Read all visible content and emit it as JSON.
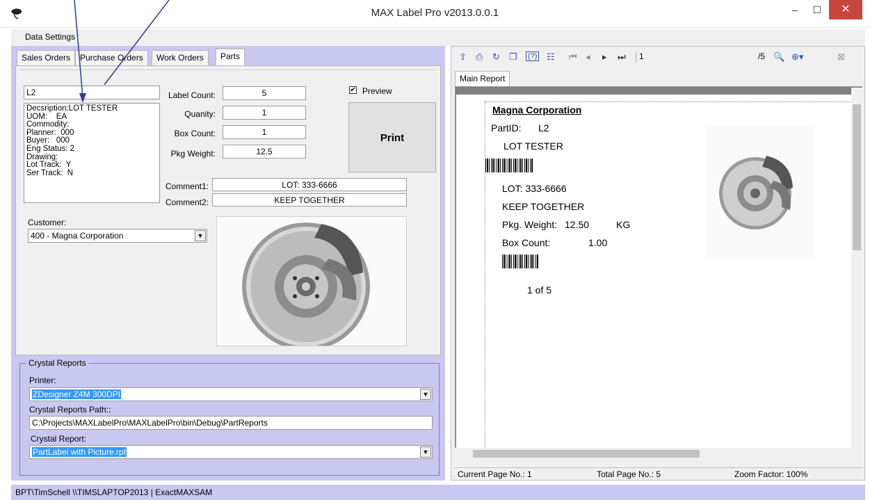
{
  "window": {
    "title": "MAX Label Pro v2013.0.0.1",
    "minimize": "–",
    "maximize": "☐",
    "close": "✕"
  },
  "menu": {
    "data_settings": "Data Settings"
  },
  "tabs": [
    "Sales Orders",
    "Purchase Orders",
    "Work Orders",
    "Parts"
  ],
  "part": {
    "part_id": "L2",
    "description_lines": [
      "Decsription:LOT TESTER",
      "UOM:    EA",
      "Commodity:",
      "Planner:  000",
      "Buyer:   000",
      "Eng Status: 2",
      "Drawing:",
      "Lot Track:  Y",
      "Ser Track:  N"
    ],
    "label_count_label": "Label Count:",
    "label_count": "5",
    "quantity_label": "Quanity:",
    "quantity": "1",
    "box_count_label": "Box Count:",
    "box_count": "1",
    "pkg_weight_label": "Pkg Weight:",
    "pkg_weight": "12.5",
    "preview_label": "Preview",
    "preview_checked": "✔",
    "print_label": "Print",
    "comment1_label": "Comment1:",
    "comment1": "LOT: 333-6666",
    "comment2_label": "Comment2:",
    "comment2": "KEEP TOGETHER",
    "customer_label": "Customer:",
    "customer": "400 - Magna Corporation"
  },
  "crystal": {
    "group_title": "Crystal Reports",
    "printer_label": "Printer:",
    "printer": "ZDesigner Z4M 300DPI",
    "path_label": "Crystal Reports Path::",
    "path": "C:\\Projects\\MAXLabelPro\\MAXLabelPro\\bin\\Debug\\PartReports",
    "report_label": "Crystal Report:",
    "report": "PartLabel with Picture.rpt"
  },
  "viewer": {
    "page_input": "1",
    "page_total": "/5",
    "main_report_tab": "Main Report",
    "current_page": "Current Page No.: 1",
    "total_pages": "Total Page No.: 5",
    "zoom": "Zoom Factor: 100%"
  },
  "report": {
    "company": "Magna Corporation",
    "part_id_label": "PartID:",
    "part_id": "L2",
    "description": "LOT TESTER",
    "lot": "LOT: 333-6666",
    "note": "KEEP TOGETHER",
    "pkg_weight_label": "Pkg. Weight:",
    "pkg_weight": "12.50",
    "pkg_weight_unit": "KG",
    "box_count_label": "Box Count:",
    "box_count": "1.00",
    "page_of": "1   of   5"
  },
  "statusbar": {
    "text": "BPT\\TimSchell  \\\\TIMSLAPTOP2013 | ExactMAXSAM"
  },
  "colors": {
    "frame": "#c8c8f0",
    "selection": "#3399ff",
    "close": "#c9463d",
    "arrow": "#2c3e8c"
  },
  "icons": [
    "app-icon",
    "export-icon",
    "print-icon",
    "refresh-icon",
    "copy-icon",
    "help-icon",
    "group-tree-icon",
    "first-page-icon",
    "prev-page-icon",
    "next-page-icon",
    "last-page-icon",
    "search-icon",
    "zoom-icon",
    "close-view-icon"
  ]
}
